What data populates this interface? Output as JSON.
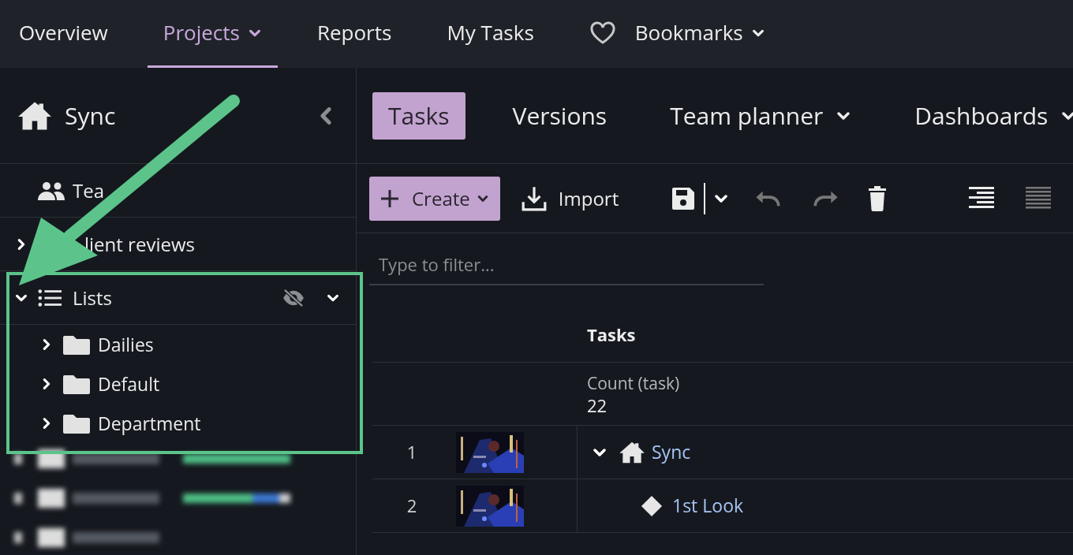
{
  "top_nav": [
    {
      "label": "Overview",
      "selected": false,
      "dropdown": false,
      "kind": "link"
    },
    {
      "label": "Projects",
      "selected": true,
      "dropdown": true,
      "kind": "link"
    },
    {
      "label": "Reports",
      "selected": false,
      "dropdown": false,
      "kind": "link"
    },
    {
      "label": "My Tasks",
      "selected": false,
      "dropdown": false,
      "kind": "link"
    },
    {
      "label": "Bookmarks",
      "selected": false,
      "dropdown": true,
      "kind": "favorites"
    }
  ],
  "sidebar": {
    "title": "Sync",
    "items": [
      {
        "label": "Tea",
        "kind": "team"
      },
      {
        "label": "lient reviews",
        "kind": "reviews",
        "expanded": false
      },
      {
        "label": "Lists",
        "kind": "lists",
        "expanded": true,
        "hidden": true,
        "children": [
          {
            "label": "Dailies",
            "kind": "folder",
            "expanded": false
          },
          {
            "label": "Default",
            "kind": "folder",
            "expanded": false
          },
          {
            "label": "Department",
            "kind": "folder",
            "expanded": false
          }
        ]
      }
    ]
  },
  "tabs": [
    {
      "label": "Tasks",
      "selected": true,
      "dropdown": false
    },
    {
      "label": "Versions",
      "selected": false,
      "dropdown": false
    },
    {
      "label": "Team planner",
      "selected": false,
      "dropdown": true
    },
    {
      "label": "Dashboards",
      "selected": false,
      "dropdown": true
    }
  ],
  "toolbar": {
    "create": "Create",
    "import": "Import"
  },
  "filter": {
    "placeholder": "Type to filter..."
  },
  "table": {
    "column_header": "Tasks",
    "summary_label": "Count (task)",
    "summary_value": "22",
    "rows": [
      {
        "number": "1",
        "name": "Sync",
        "kind": "project",
        "expanded": true,
        "children": [
          {
            "number": "2",
            "name": "1st Look",
            "kind": "milestone",
            "expanded": false
          }
        ]
      }
    ]
  }
}
